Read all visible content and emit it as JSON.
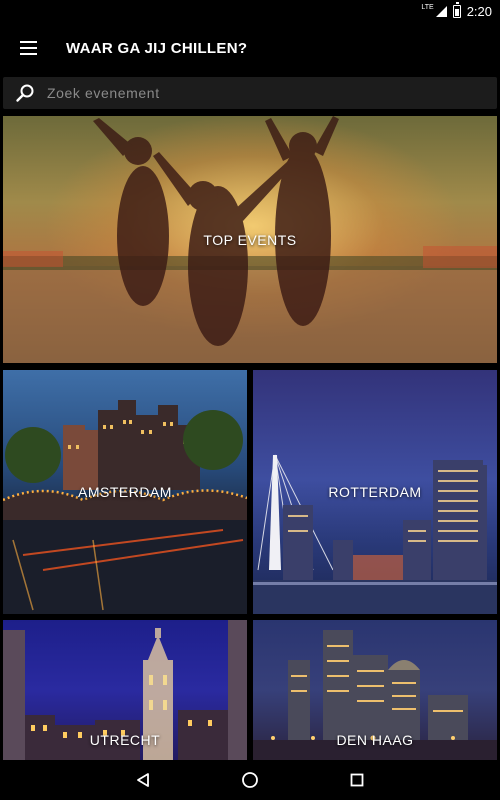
{
  "status_bar": {
    "network": "LTE",
    "time": "2:20"
  },
  "app_bar": {
    "title": "WAAR GA JIJ CHILLEN?",
    "menu_icon": "hamburger-menu-icon"
  },
  "search": {
    "placeholder": "Zoek evenement",
    "value": "",
    "icon": "search-icon"
  },
  "tiles": [
    {
      "label": "TOP EVENTS"
    },
    {
      "label": "AMSTERDAM"
    },
    {
      "label": "ROTTERDAM"
    },
    {
      "label": "UTRECHT"
    },
    {
      "label": "DEN HAAG"
    }
  ],
  "nav_bar": {
    "back_icon": "back-triangle-icon",
    "home_icon": "home-circle-icon",
    "recents_icon": "recents-square-icon"
  }
}
